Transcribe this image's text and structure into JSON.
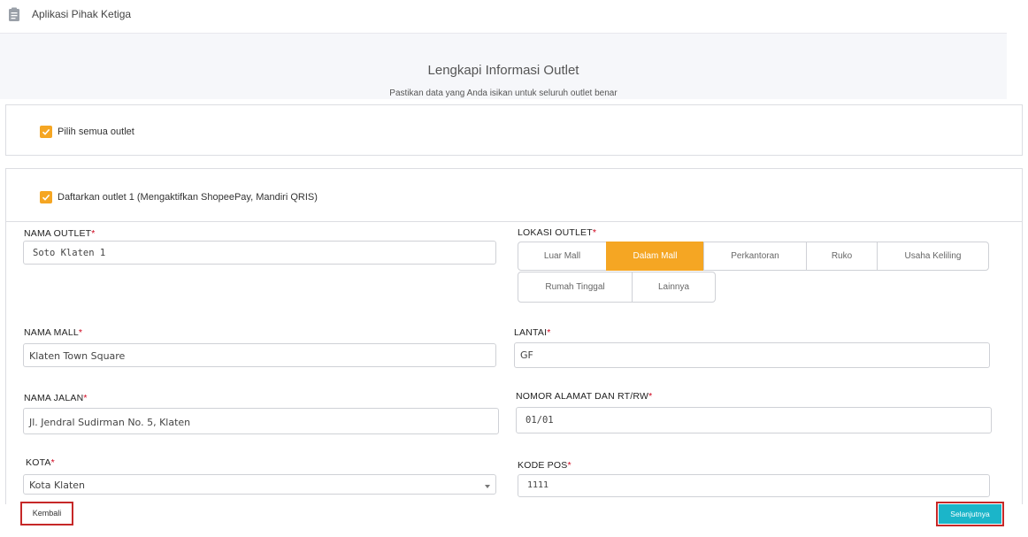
{
  "topbar": {
    "title": "Aplikasi Pihak Ketiga",
    "icon": "clipboard-icon"
  },
  "header": {
    "title": "Lengkapi Informasi Outlet",
    "subtitle": "Pastikan data yang Anda isikan untuk seluruh outlet benar"
  },
  "select_all": {
    "label": "Pilih semua outlet",
    "checked": true
  },
  "outlet": {
    "label": "Daftarkan outlet 1 (Mengaktifkan ShopeePay, Mandiri QRIS)",
    "checked": true
  },
  "form": {
    "nama_outlet": {
      "label": "NAMA OUTLET",
      "value": "Soto Klaten 1"
    },
    "lokasi_outlet": {
      "label": "LOKASI OUTLET",
      "options": [
        "Luar Mall",
        "Dalam Mall",
        "Perkantoran",
        "Ruko",
        "Usaha Keliling",
        "Rumah Tinggal",
        "Lainnya"
      ],
      "selected": "Dalam Mall"
    },
    "nama_mall": {
      "label": "NAMA MALL",
      "value": "Klaten Town Square"
    },
    "lantai": {
      "label": "LANTAI",
      "value": "GF"
    },
    "nama_jalan": {
      "label": "NAMA JALAN",
      "value": "Jl. Jendral Sudirman No. 5, Klaten"
    },
    "nomor_alamat": {
      "label": "NOMOR ALAMAT DAN RT/RW",
      "value": "01/01"
    },
    "kota": {
      "label": "KOTA",
      "value": "Kota Klaten"
    },
    "kode_pos": {
      "label": "KODE POS",
      "value": "1111"
    },
    "required_mark": "*"
  },
  "footer": {
    "back_label": "Kembali",
    "next_label": "Selanjutnya"
  },
  "colors": {
    "accent": "#f5a623",
    "primary_button": "#1bb5c9",
    "highlight_border": "#c62828"
  }
}
